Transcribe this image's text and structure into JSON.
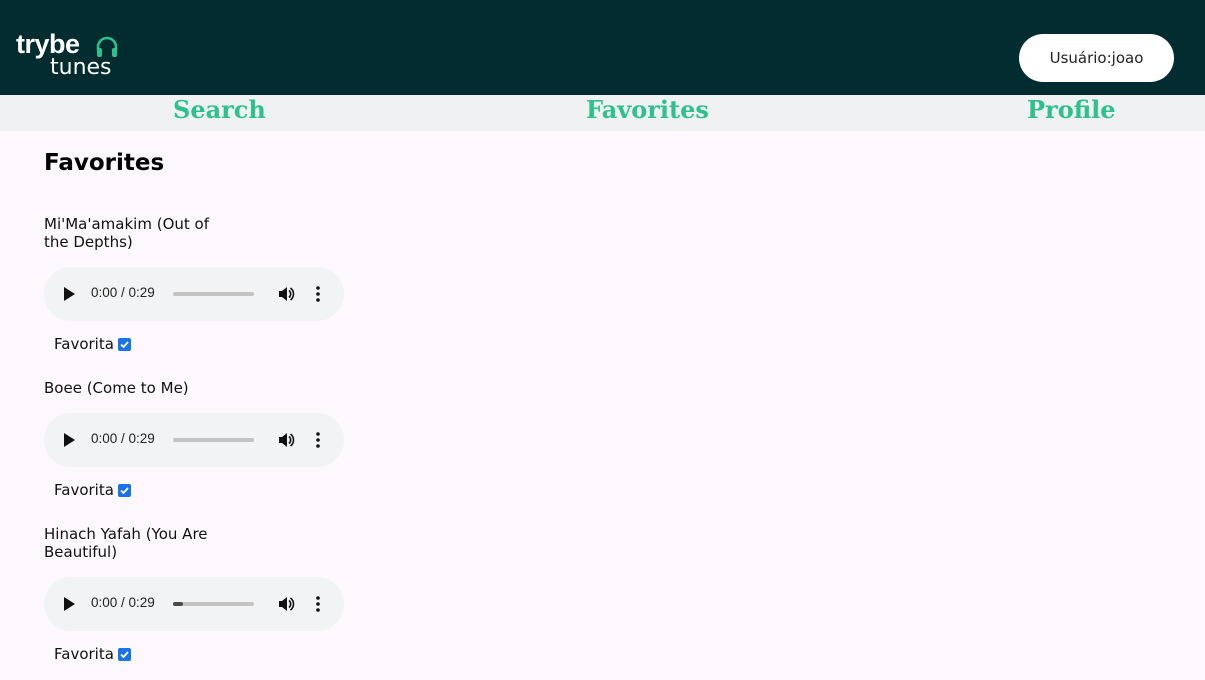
{
  "header": {
    "logo": {
      "line1": "trybe",
      "line2": "tunes"
    },
    "user_label": "Usuário:joao"
  },
  "nav": {
    "search": "Search",
    "favorites": "Favorites",
    "profile": "Profile"
  },
  "page": {
    "title": "Favorites"
  },
  "tracks": [
    {
      "name": "Mi'Ma'amakim (Out of the Depths)",
      "time": "0:00 / 0:29",
      "progress": 0.0,
      "favorite_label": "Favorita",
      "favorited": true
    },
    {
      "name": "Boee (Come to Me)",
      "time": "0:00 / 0:29",
      "progress": 0.0,
      "favorite_label": "Favorita",
      "favorited": true
    },
    {
      "name": "Hinach Yafah (You Are Beautiful)",
      "time": "0:00 / 0:29",
      "progress": 0.12,
      "favorite_label": "Favorita",
      "favorited": true
    }
  ],
  "colors": {
    "header_bg": "#022c2f",
    "accent": "#2fc18c",
    "nav_bg": "#eff1f3",
    "checkbox": "#1a73e8"
  },
  "icons": {
    "logo": "headphones-icon",
    "play": "play-icon",
    "volume": "volume-icon",
    "menu": "more-vert-icon"
  }
}
